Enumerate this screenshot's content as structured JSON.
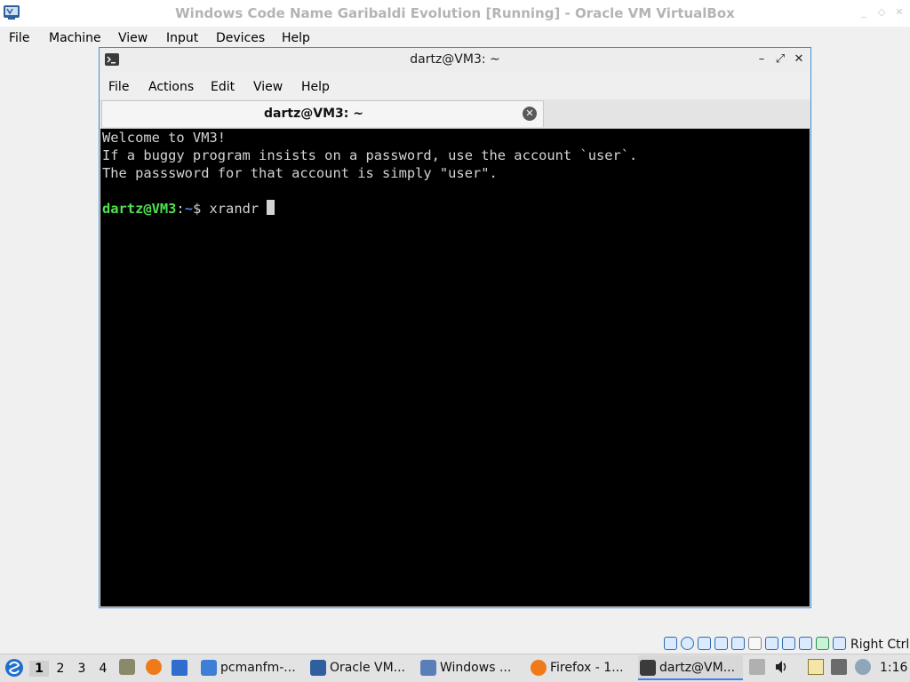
{
  "vbox": {
    "title": "Windows Code Name Garibaldi Evolution [Running] - Oracle VM VirtualBox",
    "menu": [
      "File",
      "Machine",
      "View",
      "Input",
      "Devices",
      "Help"
    ],
    "host_key": "Right Ctrl"
  },
  "terminal": {
    "window_title": "dartz@VM3: ~",
    "menu": [
      "File",
      "Actions",
      "Edit",
      "View",
      "Help"
    ],
    "tab_label": "dartz@VM3: ~",
    "lines": [
      "Welcome to VM3!",
      "If a buggy program insists on a password, use the account `user`.",
      "The passsword for that account is simply \"user\"."
    ],
    "prompt_user": "dartz@VM3",
    "prompt_sep": ":",
    "prompt_path": "~",
    "prompt_symbol": "$ ",
    "command": "xrandr "
  },
  "taskbar": {
    "workspaces": [
      "1",
      "2",
      "3",
      "4"
    ],
    "active_workspace": "1",
    "tasks": [
      {
        "label": "pcmanfm-...",
        "icon": "folder-icon"
      },
      {
        "label": "Oracle VM...",
        "icon": "virtualbox-icon"
      },
      {
        "label": "Windows ...",
        "icon": "virtualbox-vm-icon"
      },
      {
        "label": "Firefox - 1...",
        "icon": "firefox-icon"
      },
      {
        "label": "dartz@VM...",
        "icon": "terminal-icon"
      }
    ],
    "clock": "1:16"
  },
  "colors": {
    "prompt_user": "#4ee34e",
    "prompt_path": "#4b83d8",
    "terminal_bg": "#000000",
    "window_border": "#3d8fd1"
  }
}
